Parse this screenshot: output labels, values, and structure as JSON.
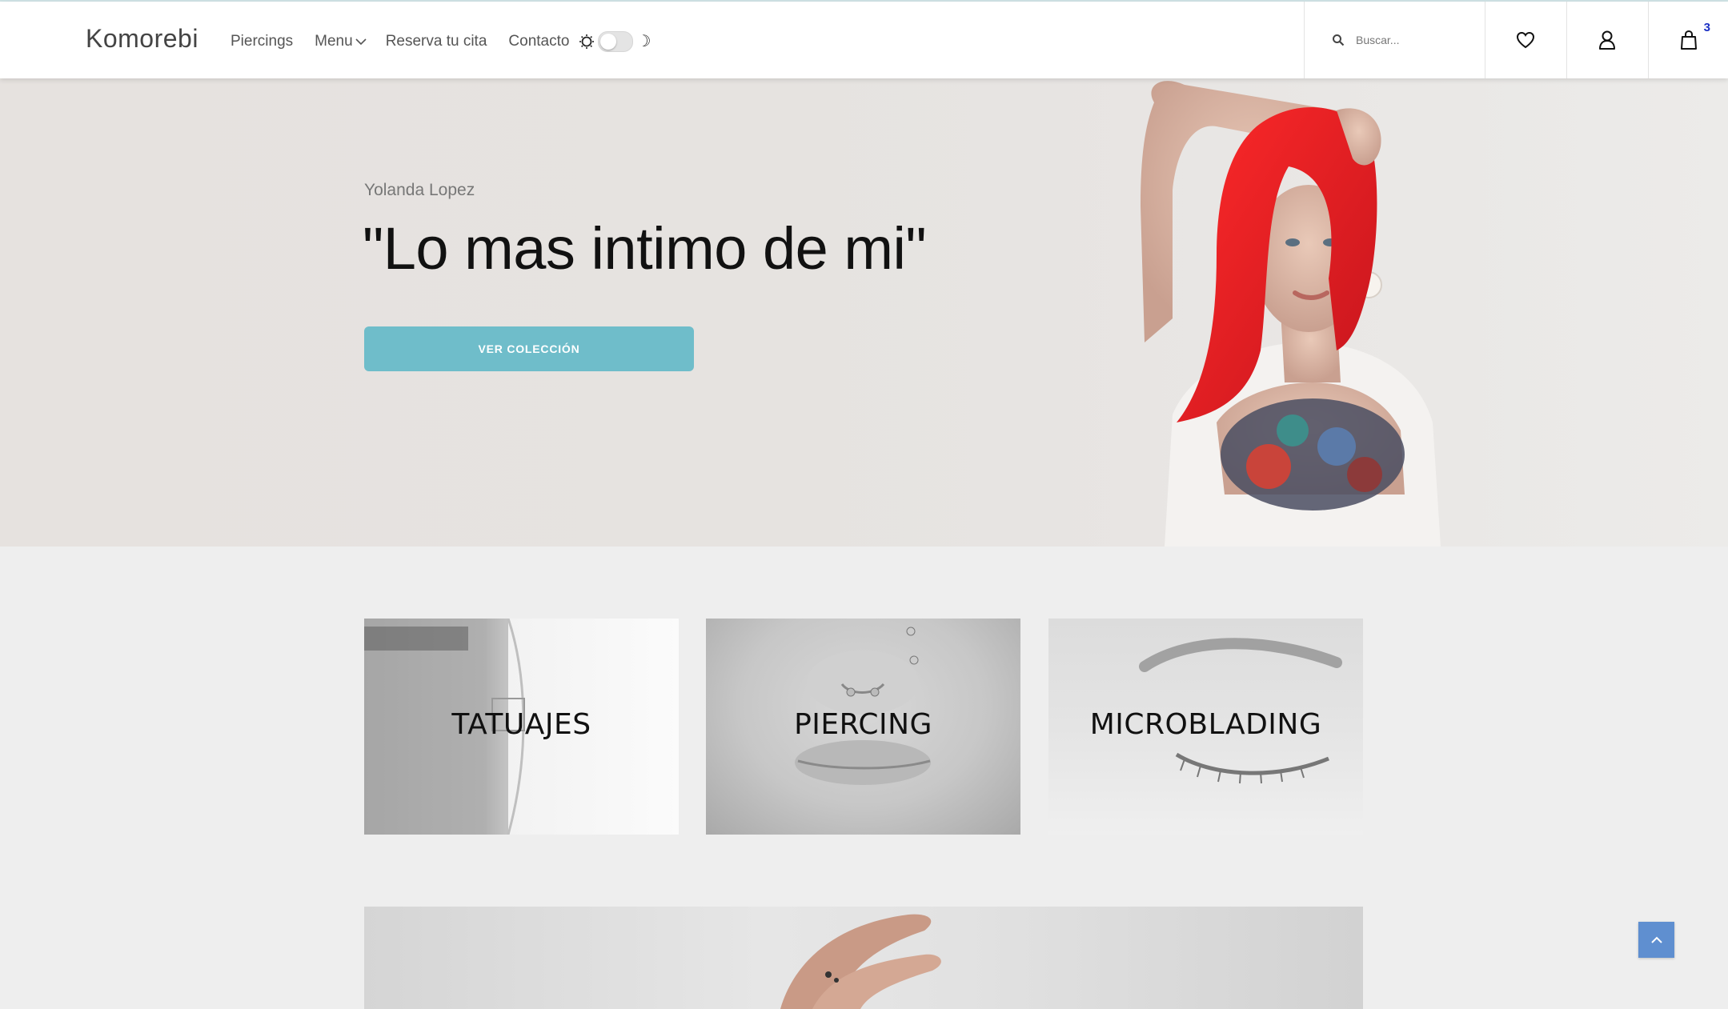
{
  "header": {
    "logo": "Komorebi",
    "nav": [
      {
        "label": "Piercings"
      },
      {
        "label": "Menu"
      },
      {
        "label": "Reserva tu cita"
      },
      {
        "label": "Contacto"
      }
    ],
    "search_placeholder": "Buscar...",
    "cart_count": "3",
    "icons": [
      "search-icon",
      "heart-icon",
      "user-icon",
      "bag-icon",
      "sun-icon",
      "moon-icon",
      "chevron-down-icon"
    ]
  },
  "hero": {
    "subtitle": "Yolanda Lopez",
    "title": "\"Lo mas intimo de mi\"",
    "button": "VER COLECCIÓN"
  },
  "categories": [
    {
      "label": "TATUAJES"
    },
    {
      "label": "PIERCING"
    },
    {
      "label": "MICROBLADING"
    }
  ],
  "colors": {
    "accent": "#6fbdca",
    "scroll_top": "#5f8fd0",
    "badge": "#1a2fc4",
    "hair": "#e2232a"
  }
}
